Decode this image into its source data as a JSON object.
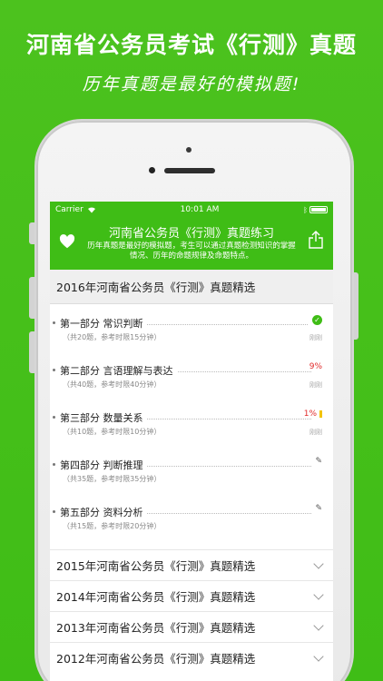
{
  "promo": {
    "title": "河南省公务员考试《行测》真题",
    "subtitle": "历年真题是最好的模拟题!"
  },
  "statusbar": {
    "carrier": "Carrier",
    "time": "10:01 AM"
  },
  "app": {
    "title": "河南省公务员《行测》真题练习",
    "description": "历年真题是最好的模拟题，考生可以通过真题检测知识的掌握情况、历年的命题规律及命题特点。"
  },
  "expanded_section": {
    "title": "2016年河南省公务员《行测》真题精选",
    "parts": [
      {
        "name": "第一部分 常识判断",
        "meta": "（共20题，参考时限15分钟）",
        "status": "done",
        "status_text": "",
        "time": "刚刚"
      },
      {
        "name": "第二部分 言语理解与表达",
        "meta": "（共40题，参考时限40分钟）",
        "status": "percent",
        "status_text": "9%",
        "time": "刚刚"
      },
      {
        "name": "第三部分 数量关系",
        "meta": "（共10题，参考时限10分钟）",
        "status": "percent",
        "status_text": "1%",
        "time": "刚刚"
      },
      {
        "name": "第四部分 判断推理",
        "meta": "（共35题，参考时限35分钟）",
        "status": "edit",
        "status_text": "",
        "time": ""
      },
      {
        "name": "第五部分 资料分析",
        "meta": "（共15题，参考时限20分钟）",
        "status": "edit",
        "status_text": "",
        "time": ""
      }
    ]
  },
  "collapsed_sections": [
    {
      "title": "2015年河南省公务员《行测》真题精选"
    },
    {
      "title": "2014年河南省公务员《行测》真题精选"
    },
    {
      "title": "2013年河南省公务员《行测》真题精选"
    },
    {
      "title": "2012年河南省公务员《行测》真题精选"
    }
  ],
  "colors": {
    "brand_green": "#3fbd16",
    "progress_red": "#e12a2a"
  },
  "icons": {
    "header_left": "heart-icon",
    "header_right": "share-icon"
  }
}
